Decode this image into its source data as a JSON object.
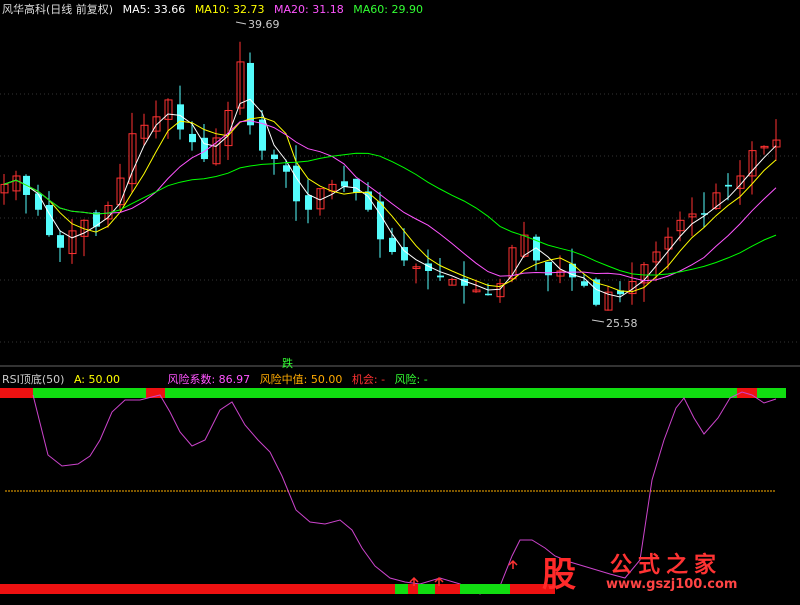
{
  "top_legend": {
    "name": "风华高科(日线 前复权)",
    "ma5": "MA5: 33.66",
    "ma10": "MA10: 32.73",
    "ma20": "MA20: 31.18",
    "ma60": "MA60: 29.90"
  },
  "price_labels": {
    "high": "39.69",
    "low": "25.58"
  },
  "signal_label": "跌",
  "bottom_legend": {
    "indicator": "RSI顶底(50)",
    "a": "A: 50.00",
    "risk_coef": "风险系数: 86.97",
    "risk_mid": "风险中值: 50.00",
    "chance": "机会: -",
    "risk": "风险: -"
  },
  "watermark": {
    "glyph": "股",
    "text": "公式之家",
    "url": "www.gszj100.com"
  },
  "colors": {
    "up": "#ff3232",
    "down": "#54fcfc",
    "ma5": "#ffffff",
    "ma10": "#ffff00",
    "ma20": "#ff55ff",
    "ma60": "#00ff00",
    "rsi": "#cc44cc",
    "midline": "#ffb000",
    "bar_red": "#ee1111",
    "bar_green": "#11dd11"
  }
}
